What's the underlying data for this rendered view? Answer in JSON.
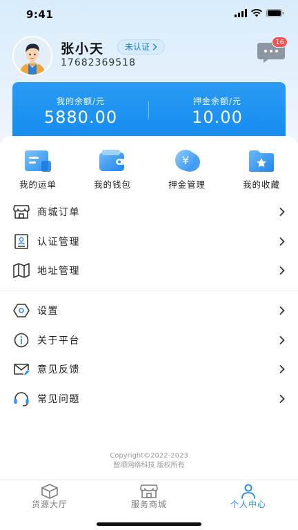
{
  "status_bar": {
    "time": "9:41"
  },
  "profile": {
    "name": "张小天",
    "verify_label": "未认证",
    "phone": "17682369518",
    "unread_count": "16"
  },
  "balance": {
    "items": [
      {
        "label": "我的余额/元",
        "value": "5880.00"
      },
      {
        "label": "押金余额/元",
        "value": "10.00"
      }
    ]
  },
  "quick_actions": [
    {
      "label": "我的运单",
      "icon": "waybill-icon"
    },
    {
      "label": "我的钱包",
      "icon": "wallet-icon"
    },
    {
      "label": "押金管理",
      "icon": "deposit-icon"
    },
    {
      "label": "我的收藏",
      "icon": "favorites-icon"
    }
  ],
  "menu_group_1": [
    {
      "label": "商城订单",
      "icon": "store-icon"
    },
    {
      "label": "认证管理",
      "icon": "id-card-icon"
    },
    {
      "label": "地址管理",
      "icon": "map-icon"
    }
  ],
  "menu_group_2": [
    {
      "label": "设置",
      "icon": "settings-icon"
    },
    {
      "label": "关于平台",
      "icon": "info-icon"
    },
    {
      "label": "意见反馈",
      "icon": "feedback-icon"
    },
    {
      "label": "常见问题",
      "icon": "headset-icon"
    }
  ],
  "footer": {
    "copyright_line1": "Copyright©2022-2023",
    "copyright_line2": "智顺网络科技 版权所有"
  },
  "tabbar": {
    "tabs": [
      {
        "label": "货源大厅",
        "icon": "box-icon",
        "active": false
      },
      {
        "label": "服务商城",
        "icon": "shop-icon",
        "active": false
      },
      {
        "label": "个人中心",
        "icon": "person-icon",
        "active": true
      }
    ]
  },
  "colors": {
    "accent": "#1a86e8",
    "card": "#148bf0",
    "badge_red": "#f45252"
  }
}
